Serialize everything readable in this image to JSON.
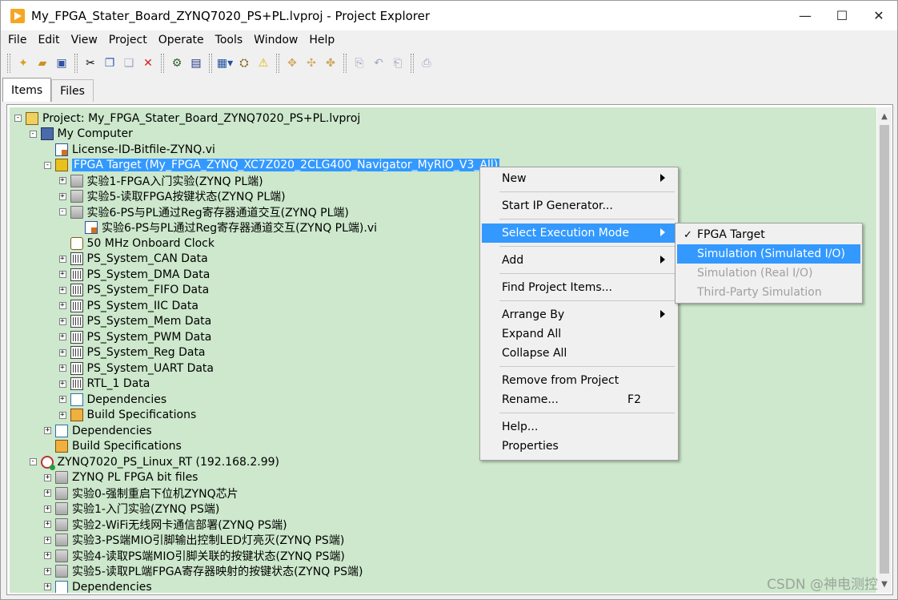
{
  "window": {
    "title": "My_FPGA_Stater_Board_ZYNQ7020_PS+PL.lvproj - Project Explorer",
    "minimize": "—",
    "maximize": "☐",
    "close": "✕"
  },
  "menubar": [
    "File",
    "Edit",
    "View",
    "Project",
    "Operate",
    "Tools",
    "Window",
    "Help"
  ],
  "tabs": [
    {
      "label": "Items",
      "active": true
    },
    {
      "label": "Files",
      "active": false
    }
  ],
  "tree": [
    {
      "level": 0,
      "exp": "-",
      "icon": "proj",
      "label": "Project: My_FPGA_Stater_Board_ZYNQ7020_PS+PL.lvproj"
    },
    {
      "level": 1,
      "exp": "-",
      "icon": "pc",
      "label": "My Computer"
    },
    {
      "level": 2,
      "exp": "",
      "icon": "vi",
      "label": "License-ID-Bitfile-ZYNQ.vi"
    },
    {
      "level": 2,
      "exp": "-",
      "icon": "fpga",
      "label": "FPGA Target (My_FPGA_ZYNQ_XC7Z020_2CLG400_Navigator_MyRIO_V3_All)",
      "selected": true
    },
    {
      "level": 3,
      "exp": "+",
      "icon": "folder",
      "label": "实验1-FPGA入门实验(ZYNQ PL端)"
    },
    {
      "level": 3,
      "exp": "+",
      "icon": "folder",
      "label": "实验5-读取FPGA按键状态(ZYNQ PL端)"
    },
    {
      "level": 3,
      "exp": "-",
      "icon": "folder",
      "label": "实验6-PS与PL通过Reg寄存器通道交互(ZYNQ PL端)"
    },
    {
      "level": 4,
      "exp": "",
      "icon": "vi",
      "label": "实验6-PS与PL通过Reg寄存器通道交互(ZYNQ PL端).vi"
    },
    {
      "level": 3,
      "exp": "",
      "icon": "clock",
      "label": "50 MHz Onboard Clock"
    },
    {
      "level": 3,
      "exp": "+",
      "icon": "chip",
      "label": "PS_System_CAN Data"
    },
    {
      "level": 3,
      "exp": "+",
      "icon": "chip",
      "label": "PS_System_DMA Data"
    },
    {
      "level": 3,
      "exp": "+",
      "icon": "chip",
      "label": "PS_System_FIFO Data"
    },
    {
      "level": 3,
      "exp": "+",
      "icon": "chip",
      "label": "PS_System_IIC Data"
    },
    {
      "level": 3,
      "exp": "+",
      "icon": "chip",
      "label": "PS_System_Mem Data"
    },
    {
      "level": 3,
      "exp": "+",
      "icon": "chip",
      "label": "PS_System_PWM Data"
    },
    {
      "level": 3,
      "exp": "+",
      "icon": "chip",
      "label": "PS_System_Reg Data"
    },
    {
      "level": 3,
      "exp": "+",
      "icon": "chip",
      "label": "PS_System_UART Data"
    },
    {
      "level": 3,
      "exp": "+",
      "icon": "chip",
      "label": "RTL_1 Data"
    },
    {
      "level": 3,
      "exp": "+",
      "icon": "dep",
      "label": "Dependencies"
    },
    {
      "level": 3,
      "exp": "+",
      "icon": "build",
      "label": "Build Specifications"
    },
    {
      "level": 2,
      "exp": "+",
      "icon": "dep",
      "label": "Dependencies"
    },
    {
      "level": 2,
      "exp": "",
      "icon": "build",
      "label": "Build Specifications"
    },
    {
      "level": 1,
      "exp": "-",
      "icon": "rt",
      "label": "ZYNQ7020_PS_Linux_RT (192.168.2.99)"
    },
    {
      "level": 2,
      "exp": "+",
      "icon": "folder",
      "label": "ZYNQ PL FPGA bit files"
    },
    {
      "level": 2,
      "exp": "+",
      "icon": "folder",
      "label": "实验0-强制重启下位机ZYNQ芯片"
    },
    {
      "level": 2,
      "exp": "+",
      "icon": "folder",
      "label": "实验1-入门实验(ZYNQ PS端)"
    },
    {
      "level": 2,
      "exp": "+",
      "icon": "folder",
      "label": "实验2-WiFi无线网卡通信部署(ZYNQ PS端)"
    },
    {
      "level": 2,
      "exp": "+",
      "icon": "folder",
      "label": "实验3-PS端MIO引脚输出控制LED灯亮灭(ZYNQ PS端)"
    },
    {
      "level": 2,
      "exp": "+",
      "icon": "folder",
      "label": "实验4-读取PS端MIO引脚关联的按键状态(ZYNQ PS端)"
    },
    {
      "level": 2,
      "exp": "+",
      "icon": "folder",
      "label": "实验5-读取PL端FPGA寄存器映射的按键状态(ZYNQ PS端)"
    },
    {
      "level": 2,
      "exp": "+",
      "icon": "dep",
      "label": "Dependencies"
    }
  ],
  "context_menu": [
    {
      "label": "New",
      "submenu": true
    },
    {
      "sep": true
    },
    {
      "label": "Start IP Generator..."
    },
    {
      "sep": true
    },
    {
      "label": "Select Execution Mode",
      "submenu": true,
      "highlighted": true
    },
    {
      "sep": true
    },
    {
      "label": "Add",
      "submenu": true
    },
    {
      "sep": true
    },
    {
      "label": "Find Project Items..."
    },
    {
      "sep": true
    },
    {
      "label": "Arrange By",
      "submenu": true
    },
    {
      "label": "Expand All"
    },
    {
      "label": "Collapse All"
    },
    {
      "sep": true
    },
    {
      "label": "Remove from Project"
    },
    {
      "label": "Rename...",
      "shortcut": "F2"
    },
    {
      "sep": true
    },
    {
      "label": "Help..."
    },
    {
      "label": "Properties"
    }
  ],
  "submenu": [
    {
      "label": "FPGA Target",
      "checked": true,
      "check": "✓"
    },
    {
      "label": "Simulation (Simulated I/O)",
      "highlighted": true
    },
    {
      "label": "Simulation (Real I/O)",
      "disabled": true
    },
    {
      "label": "Third-Party Simulation",
      "disabled": true
    }
  ],
  "watermark": "CSDN @神电测控",
  "colors": {
    "tree_bg": "#cde8cc",
    "selection": "#3399ff"
  }
}
